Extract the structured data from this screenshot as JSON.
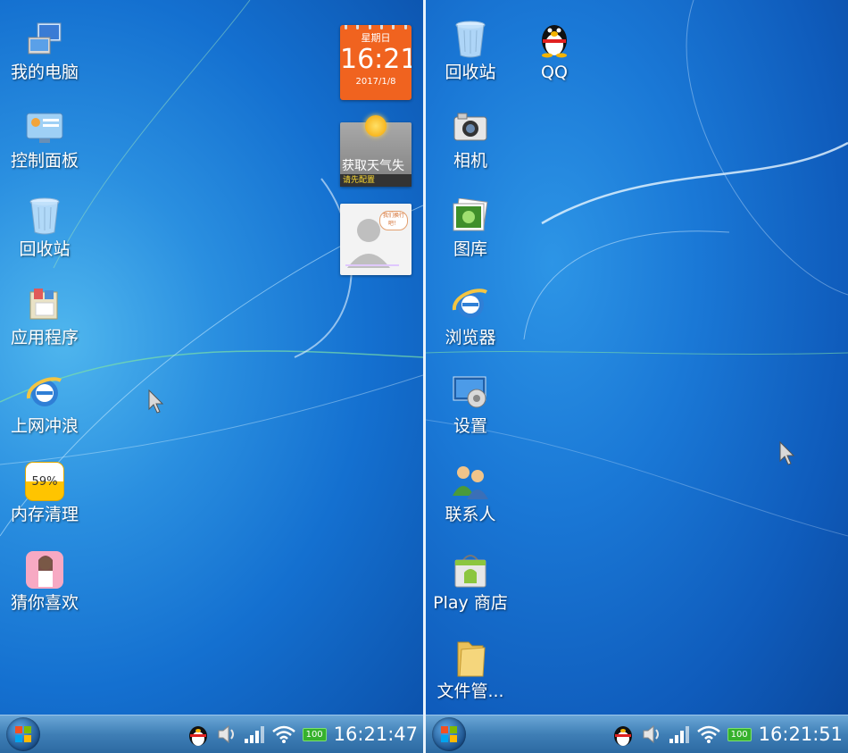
{
  "left_screen": {
    "icons": [
      {
        "label": "我的电脑",
        "icon": "computer-icon"
      },
      {
        "label": "控制面板",
        "icon": "control-panel-icon"
      },
      {
        "label": "回收站",
        "icon": "recycle-bin-icon"
      },
      {
        "label": "应用程序",
        "icon": "applications-icon"
      },
      {
        "label": "上网冲浪",
        "icon": "ie-browser-icon"
      },
      {
        "label": "内存清理",
        "icon": "memory-cleaner-icon",
        "badge": "59%"
      },
      {
        "label": "猜你喜欢",
        "icon": "guess-you-like-icon"
      }
    ],
    "clock_widget": {
      "day": "星期日",
      "time": "16:21",
      "date": "2017/1/8"
    },
    "weather_widget": {
      "title": "获取天气失",
      "subtitle": "请先配置"
    },
    "contact_widget": {
      "bubble": "我们换行吧！"
    },
    "taskbar": {
      "battery": "100",
      "time": "16:21:47"
    }
  },
  "right_screen": {
    "icons": [
      {
        "label": "回收站",
        "icon": "recycle-bin-icon"
      },
      {
        "label": "QQ",
        "icon": "qq-penguin-icon"
      },
      {
        "label": "相机",
        "icon": "camera-icon"
      },
      {
        "label": "图库",
        "icon": "gallery-icon"
      },
      {
        "label": "浏览器",
        "icon": "ie-browser-icon"
      },
      {
        "label": "设置",
        "icon": "settings-icon"
      },
      {
        "label": "联系人",
        "icon": "contacts-icon"
      },
      {
        "label": "Play 商店",
        "icon": "play-store-icon"
      },
      {
        "label": "文件管...",
        "icon": "folder-icon"
      }
    ],
    "taskbar": {
      "battery": "100",
      "time": "16:21:51"
    }
  },
  "colors": {
    "clock_widget": "#f0631f",
    "taskbar": "#3f7fb6",
    "battery": "#36b12c"
  }
}
